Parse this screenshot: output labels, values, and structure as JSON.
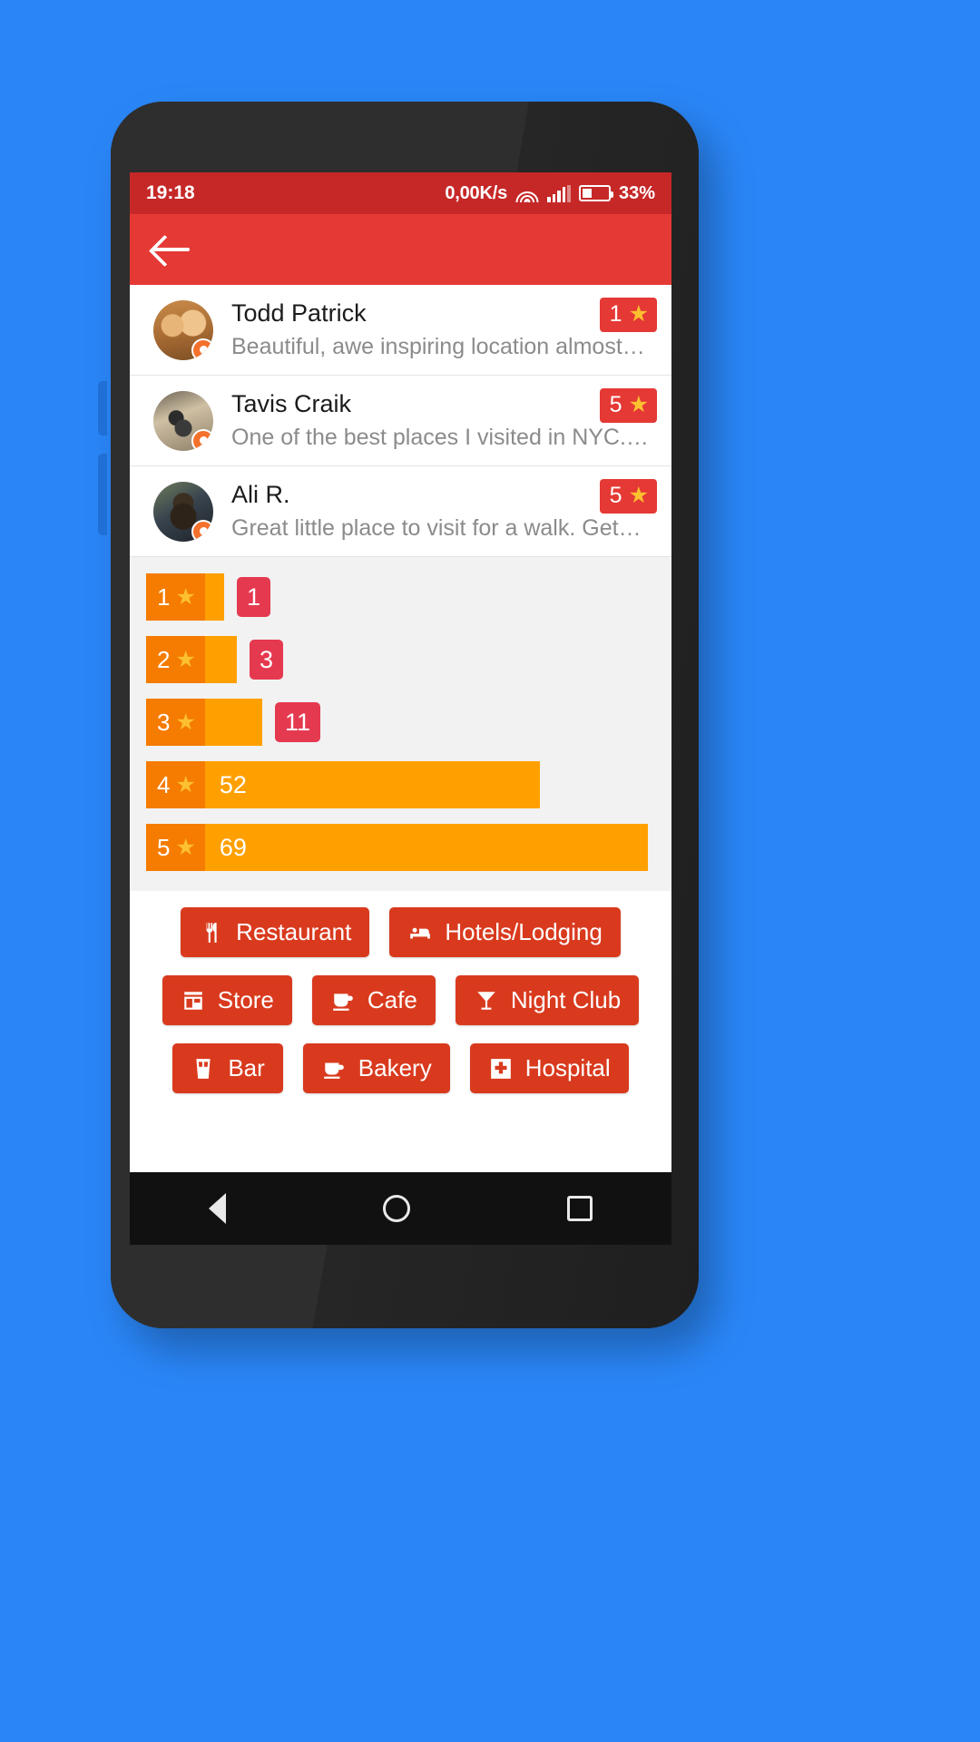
{
  "status_bar": {
    "time": "19:18",
    "net_speed": "0,00K/s",
    "wifi_icon": "wifi-icon",
    "signal_icon": "signal-icon",
    "battery_icon": "battery-icon",
    "battery_pct": "33%",
    "bg_color": "#c62828"
  },
  "app_bar": {
    "back_icon": "back-arrow-icon",
    "bg_color": "#e53935"
  },
  "reviews": [
    {
      "name": "Todd Patrick",
      "snippet": "Beautiful, awe inspiring location almost…",
      "rating": "1",
      "star": "★",
      "avatar_name": "avatar-todd-patrick"
    },
    {
      "name": "Tavis Craik",
      "snippet": "One of the best places I visited in NYC.…",
      "rating": "5",
      "star": "★",
      "avatar_name": "avatar-tavis-craik"
    },
    {
      "name": "Ali R.",
      "snippet": "Great little place to visit for a walk. Get…",
      "rating": "5",
      "star": "★",
      "avatar_name": "avatar-ali-r"
    }
  ],
  "chart_data": {
    "type": "bar",
    "title": "",
    "xlabel": "",
    "ylabel": "",
    "orientation": "horizontal",
    "categories": [
      "1",
      "2",
      "3",
      "4",
      "5"
    ],
    "values": [
      1,
      3,
      11,
      52,
      69
    ],
    "value_labels": [
      "1",
      "3",
      "11",
      "52",
      "69"
    ],
    "star_glyph": "★",
    "bar_color": "#ffa000",
    "label_color": "#f57c00",
    "outside_badge_color": "#e53950",
    "max_value": 69,
    "grid": false,
    "legend": "none"
  },
  "categories": {
    "rows": [
      [
        {
          "label": "Restaurant",
          "icon": "restaurant-icon"
        },
        {
          "label": "Hotels/Lodging",
          "icon": "hotel-bed-icon"
        }
      ],
      [
        {
          "label": "Store",
          "icon": "store-icon"
        },
        {
          "label": "Cafe",
          "icon": "cafe-cup-icon"
        },
        {
          "label": "Night Club",
          "icon": "cocktail-glass-icon"
        }
      ],
      [
        {
          "label": "Bar",
          "icon": "bar-drink-icon"
        },
        {
          "label": "Bakery",
          "icon": "bakery-cup-icon"
        },
        {
          "label": "Hospital",
          "icon": "hospital-cross-icon"
        }
      ]
    ],
    "button_color": "#d93a1e"
  },
  "nav_bar": {
    "back": "nav-back-triangle-icon",
    "home": "nav-home-circle-icon",
    "recents": "nav-recents-square-icon"
  }
}
